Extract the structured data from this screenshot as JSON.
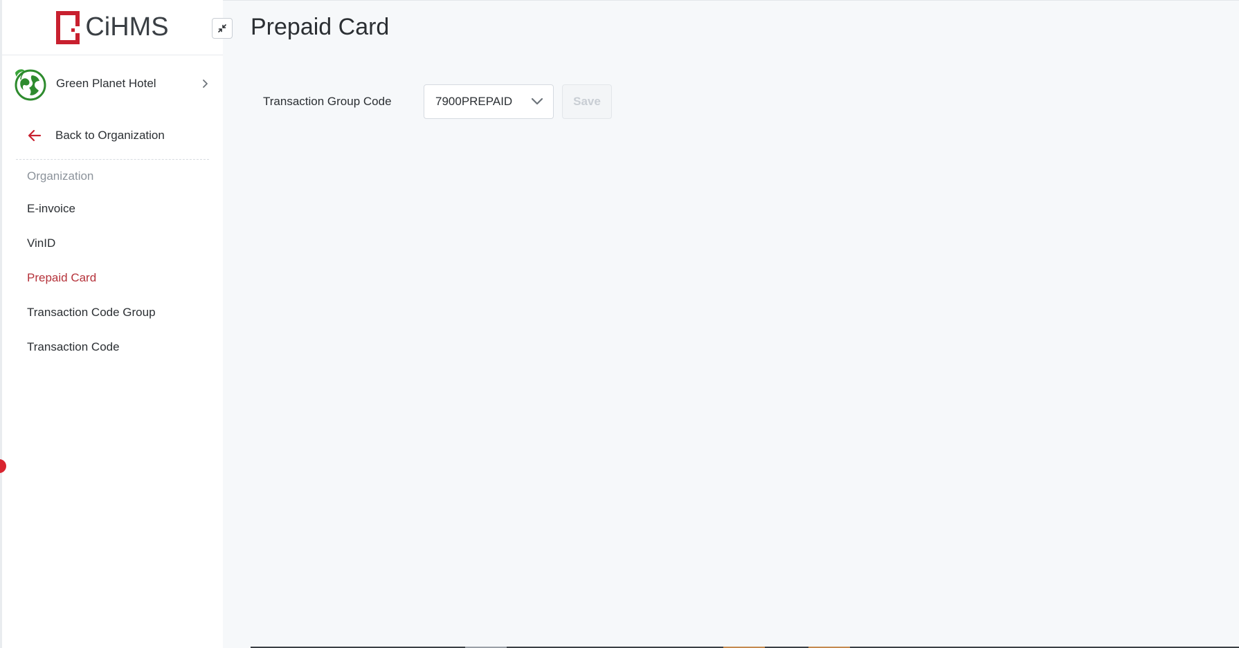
{
  "app": {
    "logo_text": "CiHMS"
  },
  "sidebar": {
    "hotel_name": "Green Planet Hotel",
    "back_label": "Back to Organization",
    "section_heading": "Organization",
    "items": [
      {
        "label": "E-invoice",
        "active": false
      },
      {
        "label": "VinID",
        "active": false
      },
      {
        "label": "Prepaid Card",
        "active": true
      },
      {
        "label": "Transaction Code Group",
        "active": false
      },
      {
        "label": "Transaction Code",
        "active": false
      }
    ]
  },
  "main": {
    "title": "Prepaid Card",
    "form": {
      "label": "Transaction Group Code",
      "selected_value": "7900PREPAID",
      "save_label": "Save",
      "save_disabled": true
    }
  },
  "colors": {
    "brand_red": "#c8202f",
    "active_text": "#b5323a",
    "main_bg": "#f6f8fa",
    "muted_text": "#8c939b"
  },
  "icons": {
    "collapse": "collapse-arrows-icon",
    "hotel": "globe-leaf-icon",
    "expand": "chevron-right-icon",
    "back": "arrow-left-icon",
    "dropdown": "chevron-down-icon"
  }
}
